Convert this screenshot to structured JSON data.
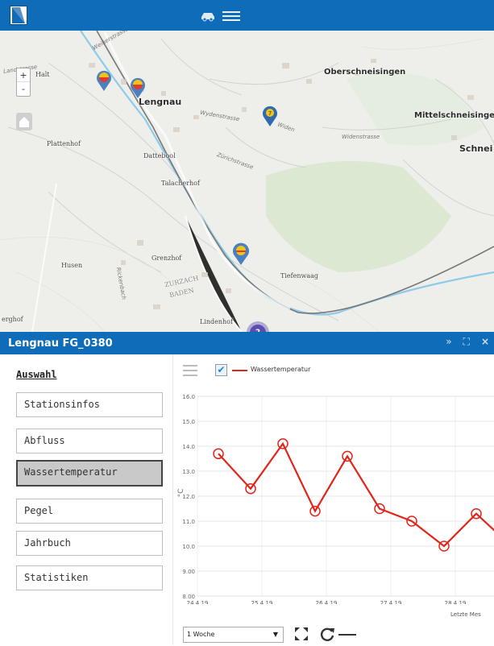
{
  "topbar": {
    "logo": "app-logo",
    "icons": [
      "car-icon",
      "menu-icon"
    ]
  },
  "map": {
    "controls": {
      "zoom_in": "+",
      "zoom_out": "-"
    },
    "places": [
      {
        "name": "Halt",
        "kind": "sm"
      },
      {
        "name": "Lengnau",
        "kind": "big"
      },
      {
        "name": "Oberschneisingen",
        "kind": "big"
      },
      {
        "name": "Mittelschneisinge",
        "kind": "big"
      },
      {
        "name": "Schnei",
        "kind": "big"
      },
      {
        "name": "Plattenhof",
        "kind": "sm"
      },
      {
        "name": "Dattebool",
        "kind": "sm"
      },
      {
        "name": "Talacherhof",
        "kind": "sm"
      },
      {
        "name": "Grenzhof",
        "kind": "sm"
      },
      {
        "name": "Husen",
        "kind": "sm"
      },
      {
        "name": "Tiefenwaag",
        "kind": "sm"
      },
      {
        "name": "ZURZACH",
        "kind": "sm"
      },
      {
        "name": "BADEN",
        "kind": "sm"
      },
      {
        "name": "Lindenhof",
        "kind": "sm"
      },
      {
        "name": "erghof",
        "kind": "sm"
      }
    ],
    "streets": [
      "Weiherstrasse",
      "Widenstrasse",
      "Widen",
      "Zürichstrasse",
      "Wydenstrasse",
      "Rickenbach",
      "Landstrasse"
    ],
    "cluster_count": "2",
    "marker_labels": [
      "7"
    ]
  },
  "panel": {
    "title": "Lengnau FG_0380",
    "header_icons": [
      "collapse-icon",
      "expand-icon",
      "close-icon"
    ],
    "header_symbols": [
      "»",
      "⛶",
      "×"
    ]
  },
  "sidebar": {
    "heading": "Auswahl",
    "items": [
      {
        "label": "Stationsinfos",
        "active": false
      },
      {
        "label": "Abfluss",
        "active": false
      },
      {
        "label": "Wassertemperatur",
        "active": true
      },
      {
        "label": "Pegel",
        "active": false
      },
      {
        "label": "Jahrbuch",
        "active": false
      },
      {
        "label": "Statistiken",
        "active": false
      }
    ]
  },
  "chart_data": {
    "type": "line",
    "title": "",
    "xlabel": "",
    "ylabel": "°C",
    "ylim": [
      8.0,
      16.0
    ],
    "y_ticks": [
      "8.00",
      "9.00",
      "10.0",
      "11.0",
      "12.0",
      "13.0",
      "14.0",
      "15.0",
      "16.0"
    ],
    "x_ticks": [
      "24.4.19",
      "25.4.19",
      "26.4.19",
      "27.4.19",
      "28.4.19"
    ],
    "series": [
      {
        "name": "Wassertemperatur",
        "color": "#e0261c",
        "x": [
          24.0,
          24.25,
          24.5,
          24.75,
          25.0,
          25.25,
          25.5,
          25.75,
          26.0,
          26.25,
          26.5
        ],
        "values": [
          13.7,
          12.3,
          14.1,
          11.4,
          13.6,
          11.5,
          11.0,
          10.0,
          11.3,
          10.1,
          10.0
        ]
      }
    ],
    "grid": true,
    "legend": "top-left"
  },
  "footer_note": "Letzte Mes",
  "bottom": {
    "period": "1 Woche",
    "icons": [
      "fullscreen-icon",
      "refresh-icon",
      "minus-icon"
    ]
  },
  "colors": {
    "primary": "#0f6cb8",
    "series": "#e0261c",
    "active_tab": "#c9c9c9"
  }
}
